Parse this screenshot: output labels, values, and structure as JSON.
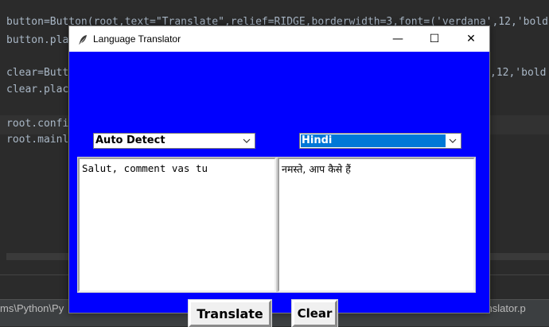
{
  "ide": {
    "code_lines": [
      "button=Button(root,text=\"Translate\",relief=RIDGE,borderwidth=3,font=('verdana',12,'bold",
      "button.pla",
      "clear=Butt",
      "clear.plac",
      "root.confi",
      "root.mainl"
    ],
    "code_right_fragment": ",12,'bold",
    "status_path": "ms\\Python\\Py",
    "status_file": "ranslator.p"
  },
  "window": {
    "title": "Language Translator",
    "minimize_glyph": "—",
    "maximize_glyph": "☐",
    "close_glyph": "✕",
    "background_color": "#0000ff"
  },
  "source_language": {
    "selected": "Auto Detect"
  },
  "target_language": {
    "selected": "Hindi"
  },
  "source_text": "Salut, comment vas tu",
  "translated_text": "नमस्ते, आप कैसे हैं",
  "buttons": {
    "translate_label": "Translate",
    "clear_label": "Clear"
  }
}
